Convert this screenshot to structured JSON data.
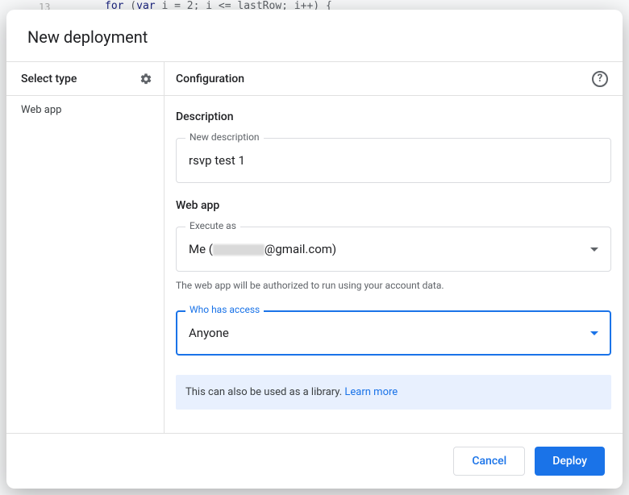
{
  "background_code": {
    "line_number": "13",
    "code": [
      "for",
      " (",
      "var",
      " i = 2; i <= lastRow; i++) {"
    ]
  },
  "modal": {
    "title": "New deployment",
    "sidebar": {
      "heading": "Select type",
      "items": [
        {
          "label": "Web app"
        }
      ]
    },
    "config": {
      "heading": "Configuration",
      "description_section": "Description",
      "description_label": "New description",
      "description_value": "rsvp test 1",
      "webapp_section": "Web app",
      "execute_as_label": "Execute as",
      "execute_as_prefix": "Me (",
      "execute_as_suffix": "@gmail.com)",
      "execute_as_helper": "The web app will be authorized to run using your account data.",
      "access_label": "Who has access",
      "access_value": "Anyone",
      "banner_text": "This can also be used as a library. ",
      "banner_link": "Learn more"
    },
    "footer": {
      "cancel": "Cancel",
      "deploy": "Deploy"
    }
  }
}
